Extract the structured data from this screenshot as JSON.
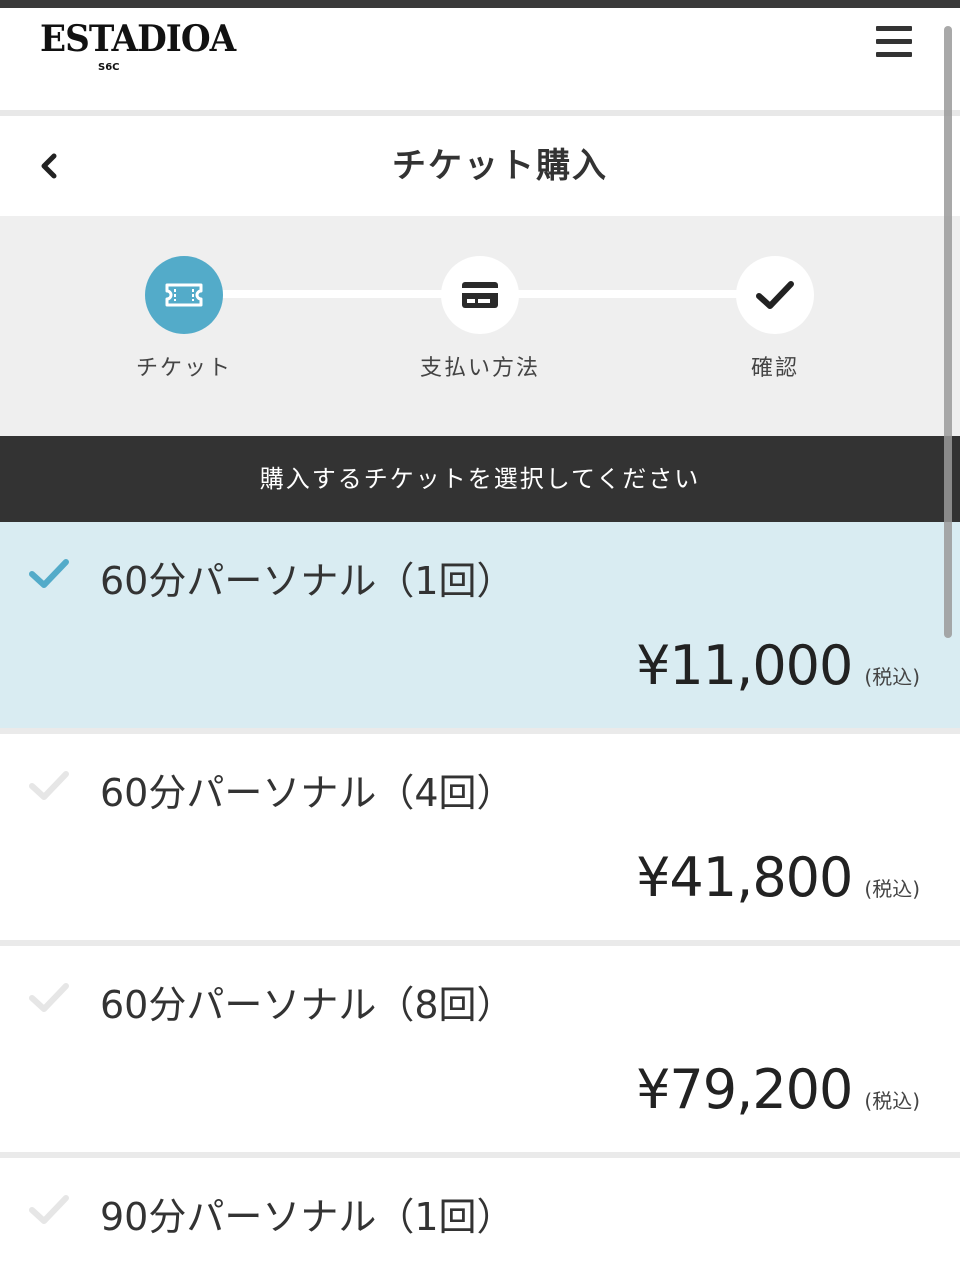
{
  "app": {
    "logo_text": "ESTADIOA",
    "logo_sub": "S6C"
  },
  "title_bar": {
    "title": "チケット購入"
  },
  "steps": [
    {
      "label": "チケット",
      "icon": "ticket-icon",
      "active": true
    },
    {
      "label": "支払い方法",
      "icon": "credit-card-icon",
      "active": false
    },
    {
      "label": "確認",
      "icon": "checkmark-icon",
      "active": false
    }
  ],
  "instruction": "購入するチケットを選択してください",
  "tickets": [
    {
      "name": "60分パーソナル（1回）",
      "price": "¥11,000",
      "tax": "(税込)",
      "selected": true
    },
    {
      "name": "60分パーソナル（4回）",
      "price": "¥41,800",
      "tax": "(税込)",
      "selected": false
    },
    {
      "name": "60分パーソナル（8回）",
      "price": "¥79,200",
      "tax": "(税込)",
      "selected": false
    },
    {
      "name": "90分パーソナル（1回）",
      "price": "",
      "tax": "",
      "selected": false
    }
  ],
  "colors": {
    "accent": "#53abc9",
    "selected_bg": "#d9ecf2",
    "dark_bar": "#333333",
    "steps_bg": "#efefef"
  }
}
